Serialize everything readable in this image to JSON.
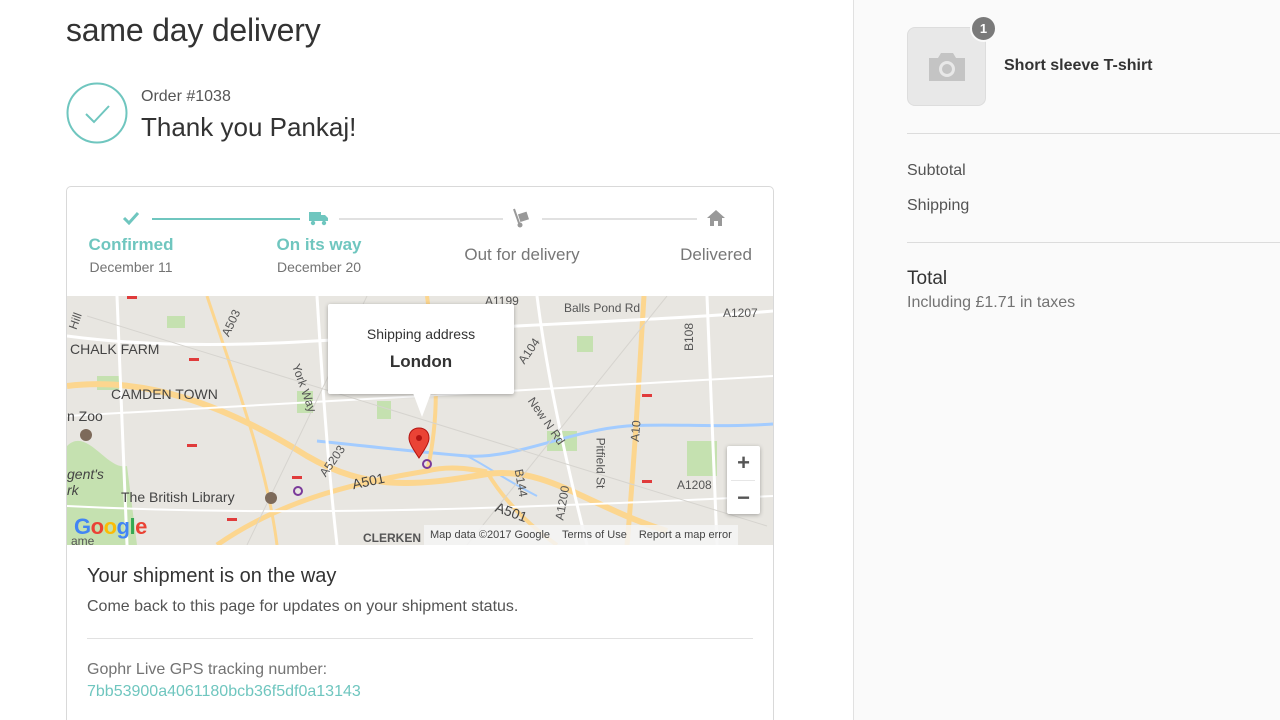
{
  "shop": {
    "title": "same day delivery"
  },
  "order": {
    "number": "Order #1038",
    "thank_you": "Thank you Pankaj!"
  },
  "timeline": {
    "steps": [
      {
        "label": "Confirmed",
        "date": "December 11",
        "state": "done",
        "icon": "check-icon"
      },
      {
        "label": "On its way",
        "date": "December 20",
        "state": "done",
        "icon": "truck-icon"
      },
      {
        "label": "Out for delivery",
        "date": "",
        "state": "pending",
        "icon": "hand-truck-icon"
      },
      {
        "label": "Delivered",
        "date": "",
        "state": "pending",
        "icon": "home-icon"
      }
    ]
  },
  "map": {
    "popup_title": "Shipping address",
    "popup_city": "London",
    "labels": {
      "chalk_farm": "CHALK FARM",
      "camden_town": "CAMDEN TOWN",
      "zoo": "n Zoo",
      "british_library": "The British Library",
      "clerkenwell": "CLERKEN",
      "balls_pond": "Balls Pond Rd",
      "a503": "A503",
      "a1199": "A1199",
      "a1207": "A1207",
      "a104": "A104",
      "b108": "B108",
      "york_way": "York Way",
      "new_n_rd": "New N Rd",
      "pitfield": "Pitfield St",
      "a10": "A10",
      "a5203": "A5203",
      "a501": "A501",
      "a501b": "A501",
      "b144": "B144",
      "a1200": "A1200",
      "a1208": "A1208",
      "hill": "Hill",
      "gents": "gent's",
      "park": "rk",
      "ame": "ame"
    },
    "zoom_in": "+",
    "zoom_out": "−",
    "google": "Google",
    "attribution": {
      "data": "Map data ©2017 Google",
      "terms": "Terms of Use",
      "report": "Report a map error"
    }
  },
  "shipment": {
    "title": "Your shipment is on the way",
    "subtitle": "Come back to this page for updates on your shipment status.",
    "tracking_label": "Gophr Live GPS tracking number:",
    "tracking_number": "7bb53900a4061180bcb36f5df0a13143"
  },
  "summary": {
    "product": {
      "name": "Short sleeve T-shirt",
      "quantity": "1",
      "icon": "camera-icon"
    },
    "subtotal_label": "Subtotal",
    "shipping_label": "Shipping",
    "total_label": "Total",
    "tax_note": "Including £1.71 in taxes"
  },
  "colors": {
    "accent": "#6fc6bf",
    "pin": "#ea4335"
  }
}
